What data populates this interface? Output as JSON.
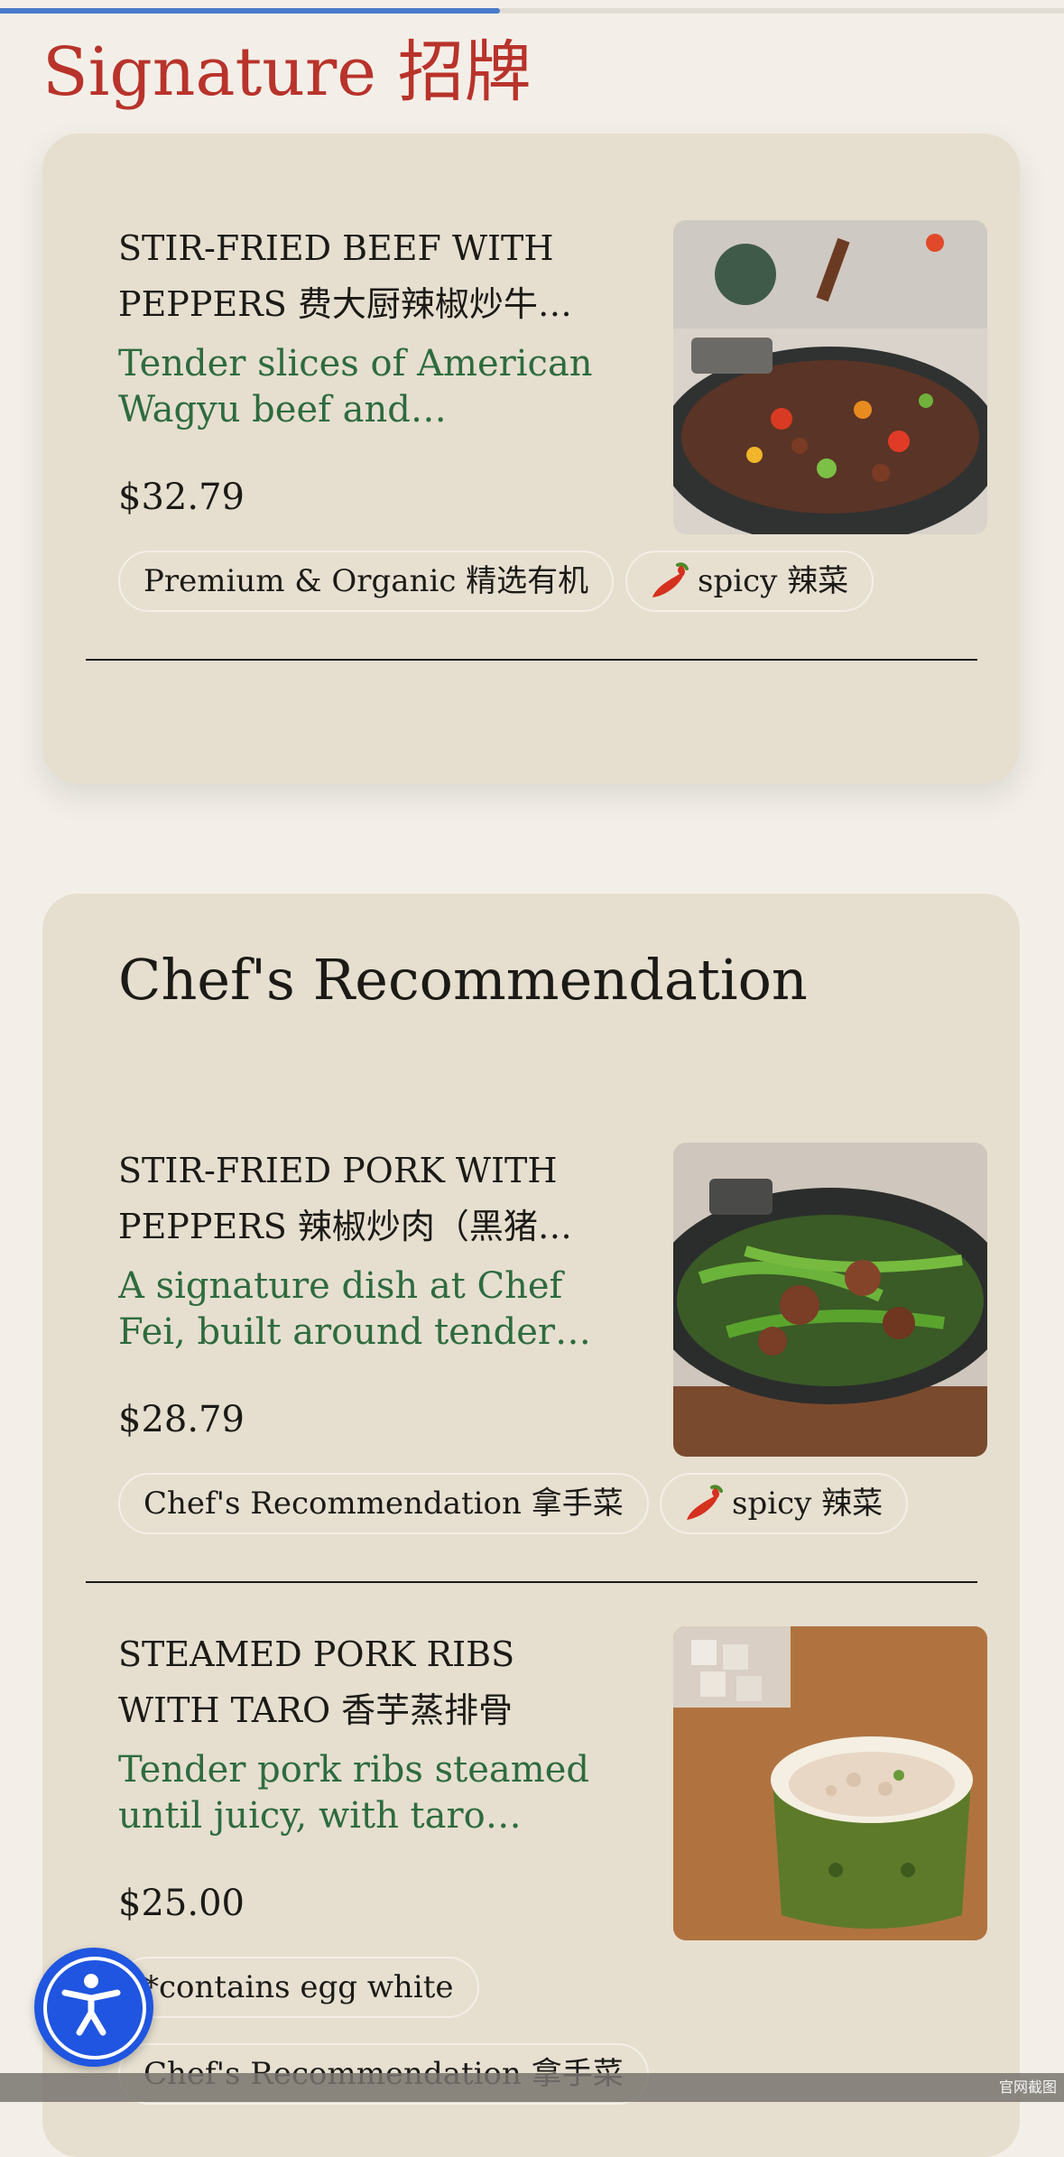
{
  "progress": {
    "value": 0.47
  },
  "signature": {
    "title": "Signature 招牌",
    "items": [
      {
        "name": "STIR-FRIED BEEF WITH PEPPERS 费大厨辣椒炒牛…",
        "description": "Tender slices of American Wagyu beef and organic…",
        "price": "$32.79",
        "tags": [
          "Premium & Organic 精选有机",
          "spicy 辣菜"
        ],
        "photo_icon": "beef-wok-photo"
      }
    ]
  },
  "chef": {
    "heading": "Chef's Recommendation",
    "items": [
      {
        "name": "STIR-FRIED PORK WITH PEPPERS 辣椒炒肉（黑猪…",
        "description": "A signature dish at Chef Fei, built around tender…",
        "price": "$28.79",
        "tags": [
          "Chef's Recommendation 拿手菜",
          "spicy 辣菜"
        ],
        "photo_icon": "pork-wok-photo"
      },
      {
        "name": "STEAMED PORK RIBS WITH TARO 香芋蒸排骨",
        "description": "Tender pork ribs steamed until juicy, with taro that…",
        "price": "$25.00",
        "tags": [
          "*contains egg white",
          "Chef's Recommendation 拿手菜"
        ],
        "photo_icon": "steamed-ribs-photo"
      }
    ]
  },
  "accessibility": {
    "icon": "accessibility-icon"
  },
  "watermark": "官网截图",
  "colors": {
    "accent_red": "#b8332b",
    "description_green": "#2e6b3f",
    "card_bg": "#e6dfcf",
    "page_bg": "#f3efe8",
    "progress_blue": "#4a7bc8",
    "a11y_blue": "#1f55e0"
  }
}
